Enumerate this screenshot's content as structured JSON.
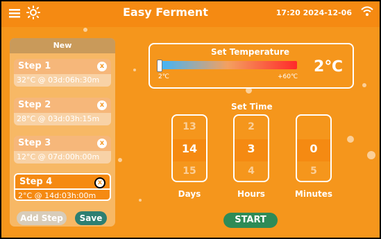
{
  "header": {
    "title": "Easy Ferment",
    "datetime": "17:20 2024-12-06"
  },
  "left_panel": {
    "heading": "New",
    "steps": [
      {
        "label": "Step 1",
        "detail": "32°C @ 03d:06h:30m"
      },
      {
        "label": "Step 2",
        "detail": "28°C @ 03d:03h:15m"
      },
      {
        "label": "Step 3",
        "detail": "12°C @ 07d:00h:00m"
      },
      {
        "label": "Step 4",
        "detail": "2°C @ 14d:03h:00m"
      }
    ],
    "add_step": "Add Step",
    "save": "Save",
    "remove_glyph": "x"
  },
  "temperature": {
    "title": "Set Temperature",
    "min_label": "2℃",
    "max_label": "+60℃",
    "value": "2℃"
  },
  "time": {
    "title": "Set Time",
    "columns": [
      {
        "label": "Days",
        "prev": "13",
        "value": "14",
        "next": "15"
      },
      {
        "label": "Hours",
        "prev": "2",
        "value": "3",
        "next": "4"
      },
      {
        "label": "Minutes",
        "prev": "",
        "value": "0",
        "next": "5"
      }
    ]
  },
  "start": "START"
}
